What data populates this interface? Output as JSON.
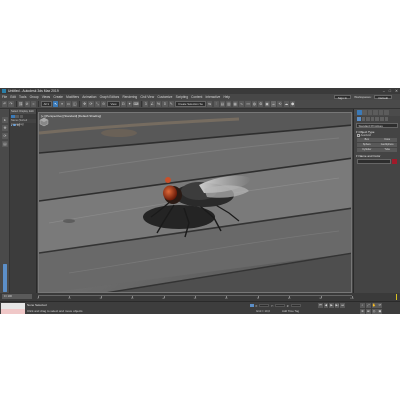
{
  "window": {
    "title": "Untitled - Autodesk 3ds Max 2019",
    "controls": [
      "–",
      "□",
      "✕"
    ]
  },
  "menu": {
    "items": [
      "File",
      "Edit",
      "Tools",
      "Group",
      "Views",
      "Create",
      "Modifiers",
      "Animation",
      "Graph Editors",
      "Rendering",
      "Civil View",
      "Customize",
      "Scripting",
      "Content",
      "Interactive",
      "Help"
    ],
    "sign_in": "Sign In",
    "workspaces_label": "Workspaces:",
    "workspace_value": "Default"
  },
  "toolbar": {
    "view_dropdown": "View",
    "selection_set_dropdown": "Create Selection Se"
  },
  "scene_explorer": {
    "header_items": [
      "Select",
      "Display",
      "Edit",
      "Custom"
    ],
    "column_header": "Name (Sorted Ascending)",
    "rows": [
      {
        "name": "Fly"
      }
    ]
  },
  "viewport": {
    "label": "[+] [Perspective] [Standard] [Default Shading]"
  },
  "command_panel": {
    "dropdown": "Standard Primitives",
    "object_type_rollout": "Object Type",
    "autogrid_label": "AutoGrid",
    "buttons": [
      "Box",
      "Cone",
      "Sphere",
      "GeoSphere",
      "Cylinder",
      "Tube",
      "Torus",
      "Pyramid",
      "Teapot",
      "Plane",
      "TextPlus",
      ""
    ],
    "name_color_rollout": "Name and Color",
    "object_color": "#a01a2a"
  },
  "timeline": {
    "frame_counter": "0 / 100",
    "tick_labels": [
      "0",
      "10",
      "20",
      "30",
      "40",
      "50",
      "60",
      "70",
      "80",
      "90",
      "100"
    ]
  },
  "status": {
    "selection": "None Selected",
    "hint": "Click and drag to select and move objects",
    "coord_labels": [
      "X:",
      "Y:",
      "Z:"
    ],
    "grid": "Grid = 10,0",
    "add_time_tag": "Add Time Tag",
    "play_controls": [
      "⏮",
      "◀",
      "▶",
      "▶|",
      "⏭"
    ],
    "nav_controls": [
      "⌕",
      "⤢",
      "✋",
      "⟳",
      "⊕",
      "⊞",
      "◎",
      "▣"
    ]
  },
  "colors": {
    "ui_bg": "#444444",
    "accent": "#3b7ab8",
    "viewport_wood": "#6b6b6b"
  }
}
